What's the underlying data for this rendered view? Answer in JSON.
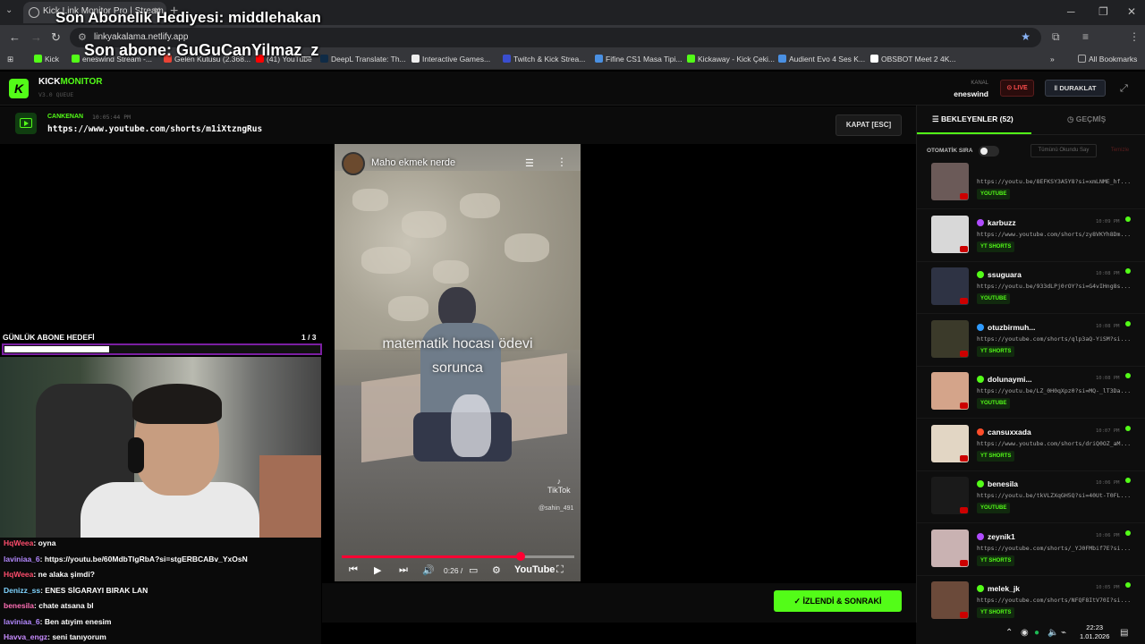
{
  "browser": {
    "tab_title": "Kick Link Monitor Pro | Stream...",
    "address": "linkyakalama.netlify.app",
    "bookmarks": [
      "Kick",
      "eneswind Stream -...",
      "Gelen Kutusu (2.368...",
      "(41) YouTube",
      "DeepL Translate: Th...",
      "Interactive Games...",
      "Twitch & Kick Strea...",
      "Fifine CS1 Masa Tipi...",
      "Kickaway - Kick Çeki...",
      "Audient Evo 4 Ses K...",
      "OBSBOT Meet 2 4K...",
      "All Bookmarks"
    ]
  },
  "stream_overlay": {
    "last_gift": "Son Abonelik Hediyesi: middlehakan",
    "last_sub": "Son abone: GuGuCanYilmaz_z"
  },
  "app": {
    "brand_a": "KICK",
    "brand_b": "MONITOR",
    "version": "V3.0 QUEUE",
    "kanal_label": "KANAL",
    "kanal": "eneswind",
    "live": "LIVE",
    "pause": "DURAKLAT"
  },
  "current": {
    "user": "CANKENAN",
    "time": "10:05:44 PM",
    "url": "https://www.youtube.com/shorts/m1iXtzngRus",
    "close": "KAPAT [ESC]"
  },
  "video": {
    "channel": "Maho ekmek nerde",
    "caption_1": "matematik hocası ödevi",
    "caption_2": "sorunca",
    "watermark": "TikTok",
    "watermark_user": "@sahin_491",
    "time": "0:26 /",
    "progress": 0.77,
    "platform": "YouTube"
  },
  "goal": {
    "label": "GÜNLÜK ABONE HEDEFİ",
    "count": "1  / 3",
    "progress": 0.333
  },
  "chat": [
    {
      "user": "HqWeea",
      "text": ": oyna",
      "color": "#ff4d6d"
    },
    {
      "user": "laviniaa_6",
      "text": ": https://youtu.be/60MdbTlgRbA?si=stgERBCABv_YxOsN",
      "color": "#b388ff"
    },
    {
      "user": "HqWeea",
      "text": ": ne alaka şimdi?",
      "color": "#ff4d6d"
    },
    {
      "user": "Denizz_ss",
      "text": ": ENES SİGARAYI BIRAK LAN",
      "color": "#7fd4ff"
    },
    {
      "user": "benesila",
      "text": ": chate atsana bl",
      "color": "#ff6fb5"
    },
    {
      "user": "laviniaa_6",
      "text": ": Ben atıyim enesim",
      "color": "#b388ff"
    },
    {
      "user": "Havva_engz",
      "text": ": seni tanıyorum",
      "color": "#c88cff"
    }
  ],
  "watched_btn": "İZLENDİ & SONRAKİ",
  "panel": {
    "tab_queue": "BEKLEYENLER (52)",
    "tab_history": "GEÇMİŞ",
    "auto_label": "OTOMATİK SIRA",
    "read_all": "Tümünü Okundu Say",
    "clear": "Temizle",
    "items": [
      {
        "name": "",
        "time": "",
        "url": "https://youtu.be/8EFKSY3A5Y8?si=xmLNME_hf...",
        "tag": "YOUTUBE",
        "badge": "#53fc18"
      },
      {
        "name": "karbuzz",
        "time": "10:09 PM",
        "url": "https://www.youtube.com/shorts/zy8VKYh8Dm...",
        "tag": "YT SHORTS",
        "badge": "#b04cff"
      },
      {
        "name": "ssuguara",
        "time": "10:08 PM",
        "url": "https://youtu.be/933dLPj0rOY?si=G4vIHng8s...",
        "tag": "YOUTUBE",
        "badge": "#53fc18"
      },
      {
        "name": "otuzbirmuh...",
        "time": "10:08 PM",
        "url": "https://youtube.com/shorts/qlp3aQ-YiSM?si...",
        "tag": "YT SHORTS",
        "badge": "#2f9bff"
      },
      {
        "name": "dolunaymi...",
        "time": "10:08 PM",
        "url": "https://youtu.be/LZ_0H0qXpz0?si=MQ-_lT3Da...",
        "tag": "YOUTUBE",
        "badge": "#53fc18"
      },
      {
        "name": "cansuxxada",
        "time": "10:07 PM",
        "url": "https://www.youtube.com/shorts/driQ0OZ_aM...",
        "tag": "YT SHORTS",
        "badge": "#ff4d2a"
      },
      {
        "name": "benesila",
        "time": "10:06 PM",
        "url": "https://youtu.be/tkVLZXqGH5Q?si=40Ut-T0FL...",
        "tag": "YOUTUBE",
        "badge": "#53fc18"
      },
      {
        "name": "zeynik1",
        "time": "10:06 PM",
        "url": "https://youtube.com/shorts/_YJ0FMbif7E?si...",
        "tag": "YT SHORTS",
        "badge": "#b04cff"
      },
      {
        "name": "melek_jk",
        "time": "10:05 PM",
        "url": "https://youtube.com/shorts/NFQF8ItV70I?si...",
        "tag": "YT SHORTS",
        "badge": "#53fc18"
      }
    ]
  },
  "tray": {
    "time": "22:23",
    "date": "1.01.2026"
  }
}
